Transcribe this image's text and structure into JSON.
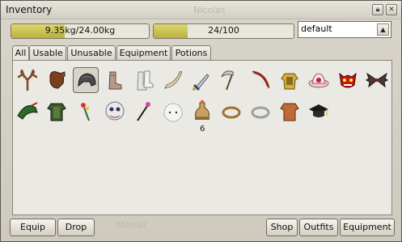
{
  "window": {
    "title": "Inventory"
  },
  "background_labels": {
    "top": "Nicolas",
    "bottom": "Mithail"
  },
  "weight": {
    "text": "9.35kg/24.00kg",
    "fraction": 0.39
  },
  "slots": {
    "text": "24/100",
    "fraction": 0.24
  },
  "filter": {
    "value": "default"
  },
  "tabs": [
    "All",
    "Usable",
    "Unusable",
    "Equipment",
    "Potions"
  ],
  "items": [
    {
      "icon": "antlers-icon"
    },
    {
      "icon": "leather-gloves-icon"
    },
    {
      "icon": "iron-helmet-icon",
      "selected": true
    },
    {
      "icon": "boots-icon"
    },
    {
      "icon": "white-boots-icon"
    },
    {
      "icon": "bone-scythe-icon"
    },
    {
      "icon": "dagger-icon"
    },
    {
      "icon": "scythe-icon"
    },
    {
      "icon": "bow-icon"
    },
    {
      "icon": "golden-armor-icon"
    },
    {
      "icon": "pink-hat-icon"
    },
    {
      "icon": "demon-mask-icon"
    },
    {
      "icon": "bat-wings-icon"
    },
    {
      "icon": "green-hat-icon"
    },
    {
      "icon": "green-armor-icon"
    },
    {
      "icon": "flower-icon"
    },
    {
      "icon": "wizard-mask-icon"
    },
    {
      "icon": "wand-icon"
    },
    {
      "icon": "furry-hat-icon"
    },
    {
      "icon": "potion-icon",
      "qty": "6"
    },
    {
      "icon": "ring-icon"
    },
    {
      "icon": "silver-ring-icon"
    },
    {
      "icon": "leather-shirt-icon"
    },
    {
      "icon": "graduation-cap-icon"
    }
  ],
  "buttons": {
    "equip": "Equip",
    "drop": "Drop",
    "shop": "Shop",
    "outfits": "Outfits",
    "equipment": "Equipment"
  }
}
